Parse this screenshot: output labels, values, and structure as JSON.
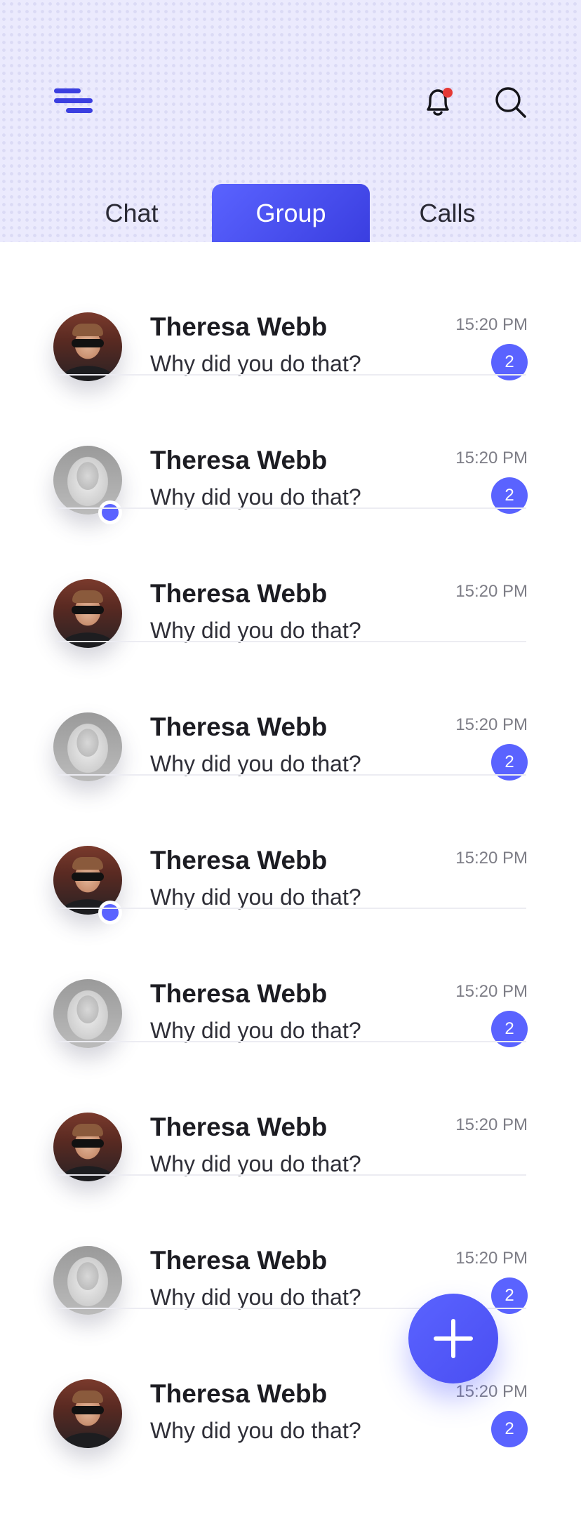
{
  "header": {
    "icons": {
      "menu": "menu-icon",
      "notifications": "bell-icon",
      "search": "search-icon"
    },
    "notification_dot_color": "#e53935",
    "accent_color": "#5a63ff"
  },
  "tabs": [
    {
      "label": "Chat",
      "active": false
    },
    {
      "label": "Group",
      "active": true
    },
    {
      "label": "Calls",
      "active": false
    }
  ],
  "chats": [
    {
      "name": "Theresa Webb",
      "message": "Why did you do that?",
      "time": "15:20 PM",
      "unread": "2",
      "avatar": "male",
      "online": false
    },
    {
      "name": "Theresa Webb",
      "message": "Why did you do that?",
      "time": "15:20 PM",
      "unread": "2",
      "avatar": "female",
      "online": true
    },
    {
      "name": "Theresa Webb",
      "message": "Why did you do that?",
      "time": "15:20 PM",
      "unread": "",
      "avatar": "male",
      "online": false
    },
    {
      "name": "Theresa Webb",
      "message": "Why did you do that?",
      "time": "15:20 PM",
      "unread": "2",
      "avatar": "female",
      "online": false
    },
    {
      "name": "Theresa Webb",
      "message": "Why did you do that?",
      "time": "15:20 PM",
      "unread": "",
      "avatar": "male",
      "online": true
    },
    {
      "name": "Theresa Webb",
      "message": "Why did you do that?",
      "time": "15:20 PM",
      "unread": "2",
      "avatar": "female",
      "online": false
    },
    {
      "name": "Theresa Webb",
      "message": "Why did you do that?",
      "time": "15:20 PM",
      "unread": "",
      "avatar": "male",
      "online": false
    },
    {
      "name": "Theresa Webb",
      "message": "Why did you do that?",
      "time": "15:20 PM",
      "unread": "2",
      "avatar": "female",
      "online": false
    },
    {
      "name": "Theresa Webb",
      "message": "Why did you do that?",
      "time": "15:20 PM",
      "unread": "2",
      "avatar": "male",
      "online": false
    }
  ],
  "fab": {
    "icon": "plus-icon"
  }
}
